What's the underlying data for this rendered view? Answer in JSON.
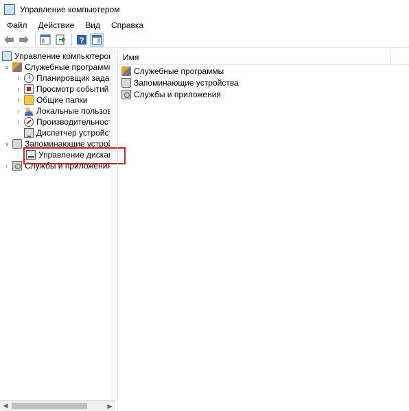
{
  "window": {
    "title": "Управление компьютером"
  },
  "menu": [
    "Файл",
    "Действие",
    "Вид",
    "Справка"
  ],
  "toolbar": {
    "buttons": [
      "back-arrow",
      "forward-arrow",
      "console-tree",
      "export-list",
      "help",
      "show-hide-action-pane"
    ]
  },
  "tree": {
    "root": "Управление компьютером (л",
    "system_tools": "Служебные программы",
    "task_scheduler": "Планировщик заданий",
    "event_viewer": "Просмотр событий",
    "shared_folders": "Общие папки",
    "local_users": "Локальные пользовате",
    "performance": "Производительность",
    "device_manager": "Диспетчер устройств",
    "storage": "Запоминающие устройст",
    "disk_management": "Управление дисками",
    "services_apps": "Службы и приложения"
  },
  "list": {
    "header_name": "Имя",
    "items": [
      "Служебные программы",
      "Запоминающие устройства",
      "Службы и приложения"
    ]
  },
  "colors": {
    "highlight": "#d01c24",
    "selection": "#cce4f7"
  }
}
